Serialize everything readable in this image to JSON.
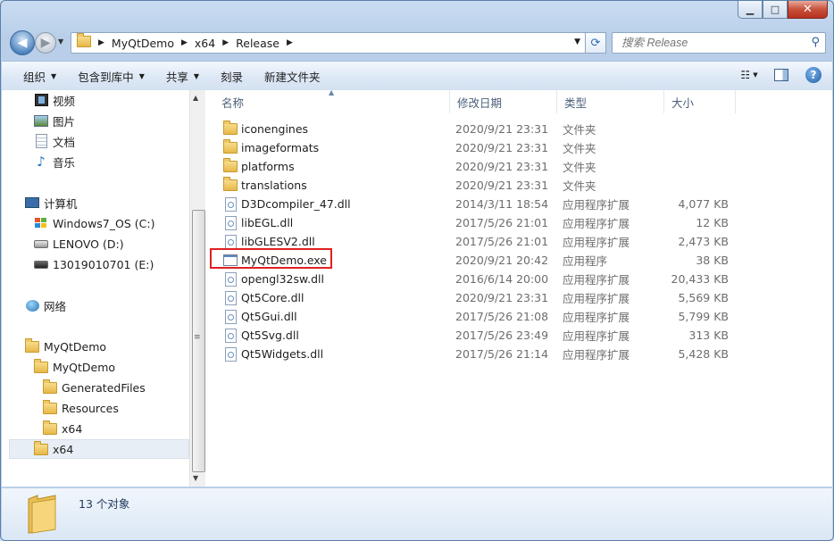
{
  "window": {
    "caption_buttons": [
      "minimize",
      "maximize",
      "close"
    ]
  },
  "address": {
    "crumbs": [
      "MyQtDemo",
      "x64",
      "Release"
    ]
  },
  "search": {
    "placeholder": "搜索 Release"
  },
  "toolbar": {
    "organize": "组织",
    "include_in_library": "包含到库中",
    "share": "共享",
    "burn": "刻录",
    "new_folder": "新建文件夹"
  },
  "nav": {
    "videos": "视频",
    "pictures": "图片",
    "documents": "文档",
    "music": "音乐",
    "computer": "计算机",
    "drive_c": "Windows7_OS (C:)",
    "drive_d": "LENOVO (D:)",
    "drive_e": "13019010701 (E:)",
    "network": "网络",
    "tree_root": "MyQtDemo",
    "tree_project": "MyQtDemo",
    "tree_generated": "GeneratedFiles",
    "tree_resources": "Resources",
    "tree_x64_inner": "x64",
    "tree_x64_selected": "x64"
  },
  "columns": {
    "name": "名称",
    "date": "修改日期",
    "type": "类型",
    "size": "大小"
  },
  "files": [
    {
      "name": "iconengines",
      "date": "2020/9/21 23:31",
      "type": "文件夹",
      "size": "",
      "icon": "folder-icon"
    },
    {
      "name": "imageformats",
      "date": "2020/9/21 23:31",
      "type": "文件夹",
      "size": "",
      "icon": "folder-icon"
    },
    {
      "name": "platforms",
      "date": "2020/9/21 23:31",
      "type": "文件夹",
      "size": "",
      "icon": "folder-icon"
    },
    {
      "name": "translations",
      "date": "2020/9/21 23:31",
      "type": "文件夹",
      "size": "",
      "icon": "folder-icon"
    },
    {
      "name": "D3Dcompiler_47.dll",
      "date": "2014/3/11 18:54",
      "type": "应用程序扩展",
      "size": "4,077 KB",
      "icon": "dll-icon"
    },
    {
      "name": "libEGL.dll",
      "date": "2017/5/26 21:01",
      "type": "应用程序扩展",
      "size": "12 KB",
      "icon": "dll-icon"
    },
    {
      "name": "libGLESV2.dll",
      "date": "2017/5/26 21:01",
      "type": "应用程序扩展",
      "size": "2,473 KB",
      "icon": "dll-icon"
    },
    {
      "name": "MyQtDemo.exe",
      "date": "2020/9/21 20:42",
      "type": "应用程序",
      "size": "38 KB",
      "icon": "exe-icon"
    },
    {
      "name": "opengl32sw.dll",
      "date": "2016/6/14 20:00",
      "type": "应用程序扩展",
      "size": "20,433 KB",
      "icon": "dll-icon"
    },
    {
      "name": "Qt5Core.dll",
      "date": "2020/9/21 23:31",
      "type": "应用程序扩展",
      "size": "5,569 KB",
      "icon": "dll-icon"
    },
    {
      "name": "Qt5Gui.dll",
      "date": "2017/5/26 21:08",
      "type": "应用程序扩展",
      "size": "5,799 KB",
      "icon": "dll-icon"
    },
    {
      "name": "Qt5Svg.dll",
      "date": "2017/5/26 23:49",
      "type": "应用程序扩展",
      "size": "313 KB",
      "icon": "dll-icon"
    },
    {
      "name": "Qt5Widgets.dll",
      "date": "2017/5/26 21:14",
      "type": "应用程序扩展",
      "size": "5,428 KB",
      "icon": "dll-icon"
    }
  ],
  "details": {
    "count": "13 个对象"
  },
  "colors": {
    "highlight_border": "#e02020",
    "accent": "#1f5fa8"
  }
}
